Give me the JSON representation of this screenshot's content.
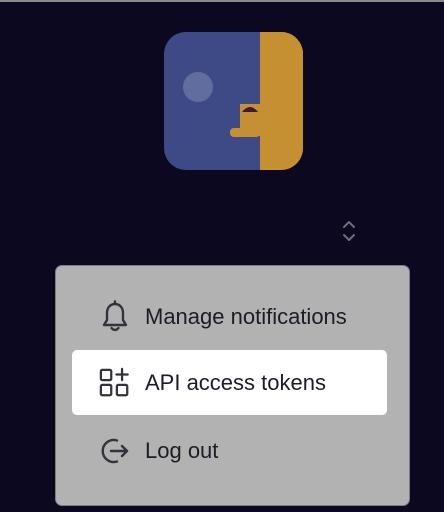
{
  "user": {
    "avatar_icon": "python-logo-icon"
  },
  "account_toggle": {
    "icon": "chevron-up-down-icon"
  },
  "menu": {
    "items": [
      {
        "label": "Manage notifications",
        "icon": "bell-icon",
        "active": false
      },
      {
        "label": "API access tokens",
        "icon": "grid-plus-icon",
        "active": true
      },
      {
        "label": "Log out",
        "icon": "logout-icon",
        "active": false
      }
    ]
  },
  "colors": {
    "background": "#0b0820",
    "menu_background": "#b2b2b2",
    "active_item": "#ffffff",
    "avatar_blue": "#3e4a86",
    "avatar_gold": "#c49032"
  }
}
